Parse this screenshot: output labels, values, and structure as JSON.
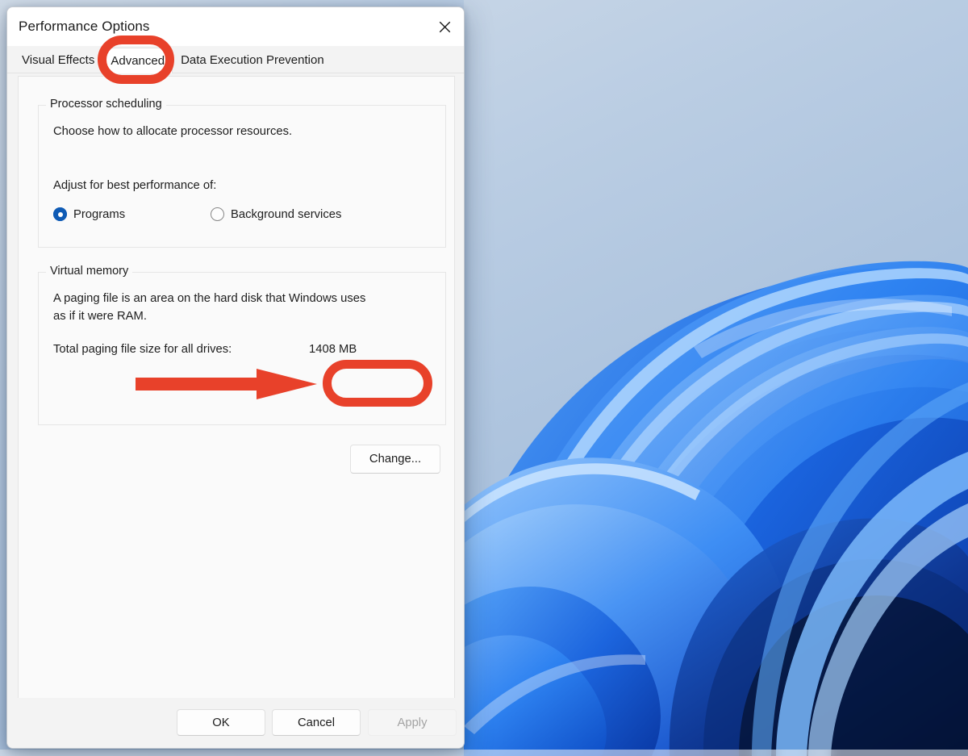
{
  "window": {
    "title": "Performance Options",
    "close_icon": "close-icon"
  },
  "tabs": [
    {
      "label": "Visual Effects",
      "selected": false
    },
    {
      "label": "Advanced",
      "selected": true
    },
    {
      "label": "Data Execution Prevention",
      "selected": false
    }
  ],
  "processor_scheduling": {
    "legend": "Processor scheduling",
    "description": "Choose how to allocate processor resources.",
    "prompt": "Adjust for best performance of:",
    "options": [
      {
        "label": "Programs",
        "checked": true
      },
      {
        "label": "Background services",
        "checked": false
      }
    ]
  },
  "virtual_memory": {
    "legend": "Virtual memory",
    "description_line1": "A paging file is an area on the hard disk that Windows uses",
    "description_line2": "as if it were RAM.",
    "total_label": "Total paging file size for all drives:",
    "total_value": "1408 MB",
    "change_button": "Change..."
  },
  "footer": {
    "ok": "OK",
    "cancel": "Cancel",
    "apply": "Apply",
    "apply_enabled": false
  },
  "annotations": {
    "color": "#E8412A",
    "highlight_tab": "Advanced",
    "highlight_button": "Change...",
    "arrow_direction": "right"
  },
  "desktop": {
    "wallpaper_name": "windows-11-bloom-blue",
    "sky_color": "#BCCEE2",
    "bloom_color": "#1A6EF5"
  }
}
